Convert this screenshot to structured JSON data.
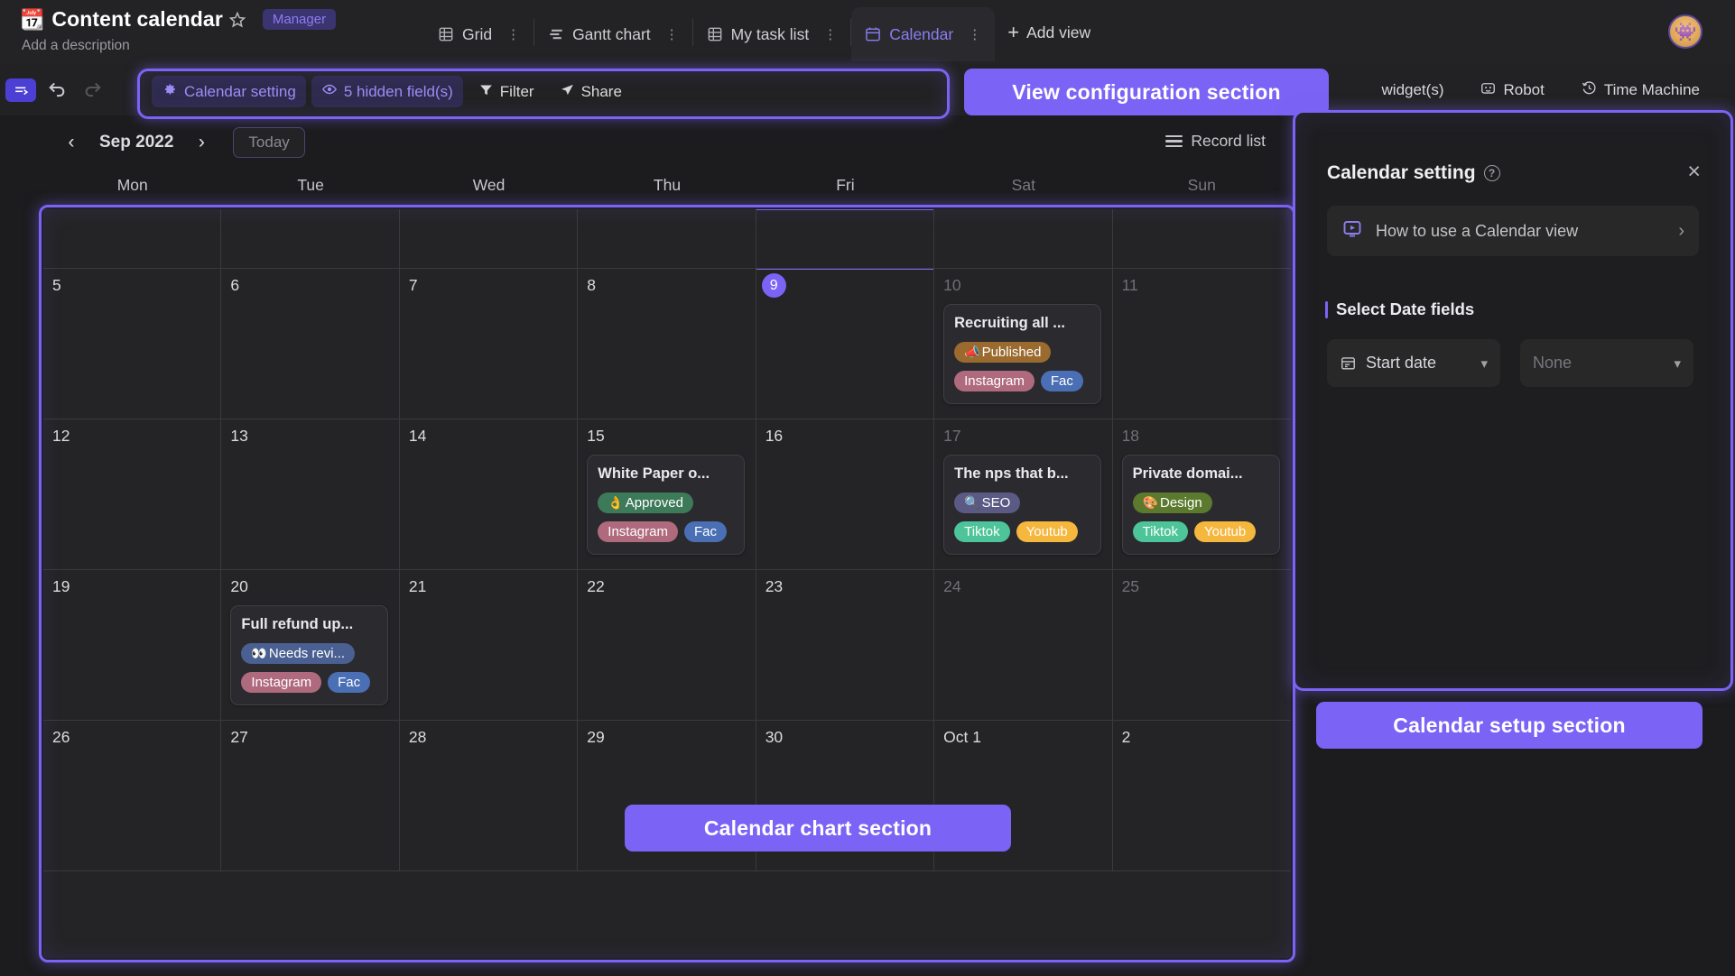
{
  "titlebar": {
    "icon": "calendar-emoji-icon",
    "title": "Content calendar",
    "badge": "Manager",
    "description": "Add a description"
  },
  "tabs": [
    {
      "label": "Grid",
      "icon": "grid-icon",
      "active": false
    },
    {
      "label": "Gantt chart",
      "icon": "gantt-icon",
      "active": false
    },
    {
      "label": "My task list",
      "icon": "list-icon",
      "active": false
    },
    {
      "label": "Calendar",
      "icon": "calendar-icon",
      "active": true
    }
  ],
  "add_view": "Add view",
  "toolbar": {
    "calendar_setting": "Calendar setting",
    "hidden_fields": "5 hidden field(s)",
    "filter": "Filter",
    "share": "Share",
    "widgets": "widget(s)",
    "robot": "Robot",
    "time_machine": "Time Machine"
  },
  "annotations": {
    "view_configuration": "View configuration section",
    "calendar_setup": "Calendar setup section",
    "calendar_chart": "Calendar chart section"
  },
  "calendar_header": {
    "prev": "‹",
    "month": "Sep 2022",
    "next": "›",
    "today": "Today",
    "record_list": "Record list"
  },
  "weekdays": [
    {
      "label": "Mon",
      "dim": false
    },
    {
      "label": "Tue",
      "dim": false
    },
    {
      "label": "Wed",
      "dim": false
    },
    {
      "label": "Thu",
      "dim": false
    },
    {
      "label": "Fri",
      "dim": false
    },
    {
      "label": "Sat",
      "dim": true
    },
    {
      "label": "Sun",
      "dim": true
    }
  ],
  "chart_data": {
    "type": "table",
    "title": "Sep 2022",
    "columns": [
      "Mon",
      "Tue",
      "Wed",
      "Thu",
      "Fri",
      "Sat",
      "Sun"
    ],
    "rows": [
      [
        {
          "day": "",
          "dim": false,
          "today": false,
          "events": []
        },
        {
          "day": "",
          "dim": false,
          "today": false,
          "events": []
        },
        {
          "day": "",
          "dim": false,
          "today": false,
          "events": []
        },
        {
          "day": "",
          "dim": false,
          "today": false,
          "events": []
        },
        {
          "day": "",
          "dim": false,
          "today": false,
          "events": [],
          "today_col": true
        },
        {
          "day": "",
          "dim": false,
          "today": false,
          "events": []
        },
        {
          "day": "",
          "dim": false,
          "today": false,
          "events": []
        }
      ],
      [
        {
          "day": "5",
          "dim": false,
          "today": false,
          "events": []
        },
        {
          "day": "6",
          "dim": false,
          "today": false,
          "events": []
        },
        {
          "day": "7",
          "dim": false,
          "today": false,
          "events": []
        },
        {
          "day": "8",
          "dim": false,
          "today": false,
          "events": []
        },
        {
          "day": "9",
          "dim": false,
          "today": true,
          "events": [],
          "today_col": true
        },
        {
          "day": "10",
          "dim": true,
          "today": false,
          "events": [
            {
              "title": "Recruiting all ...",
              "status": {
                "label": "Published",
                "emoji": "📣",
                "color": "#9a6a2e"
              },
              "channels": [
                {
                  "label": "Instagram",
                  "color": "#b06a7e"
                },
                {
                  "label": "Fac",
                  "color": "#4a6fb5"
                }
              ]
            }
          ]
        },
        {
          "day": "11",
          "dim": true,
          "today": false,
          "events": []
        }
      ],
      [
        {
          "day": "12",
          "dim": false,
          "today": false,
          "events": []
        },
        {
          "day": "13",
          "dim": false,
          "today": false,
          "events": []
        },
        {
          "day": "14",
          "dim": false,
          "today": false,
          "events": []
        },
        {
          "day": "15",
          "dim": false,
          "today": false,
          "events": [
            {
              "title": "White Paper o...",
              "status": {
                "label": "Approved",
                "emoji": "👌",
                "color": "#3d7a5a"
              },
              "channels": [
                {
                  "label": "Instagram",
                  "color": "#b06a7e"
                },
                {
                  "label": "Fac",
                  "color": "#4a6fb5"
                }
              ]
            }
          ]
        },
        {
          "day": "16",
          "dim": false,
          "today": false,
          "events": []
        },
        {
          "day": "17",
          "dim": true,
          "today": false,
          "events": [
            {
              "title": "The nps that b...",
              "status": {
                "label": "SEO",
                "emoji": "🔍",
                "color": "#5a5a85"
              },
              "channels": [
                {
                  "label": "Tiktok",
                  "color": "#4ec49a"
                },
                {
                  "label": "Youtub",
                  "color": "#f5b73e"
                }
              ]
            }
          ]
        },
        {
          "day": "18",
          "dim": true,
          "today": false,
          "events": [
            {
              "title": "Private domai...",
              "status": {
                "label": "Design",
                "emoji": "🎨",
                "color": "#5b7a2e"
              },
              "channels": [
                {
                  "label": "Tiktok",
                  "color": "#4ec49a"
                },
                {
                  "label": "Youtub",
                  "color": "#f5b73e"
                }
              ]
            }
          ]
        }
      ],
      [
        {
          "day": "19",
          "dim": false,
          "today": false,
          "events": []
        },
        {
          "day": "20",
          "dim": false,
          "today": false,
          "events": [
            {
              "title": "Full refund up...",
              "status": {
                "label": "Needs revi...",
                "emoji": "👀",
                "color": "#4a6092"
              },
              "channels": [
                {
                  "label": "Instagram",
                  "color": "#b06a7e"
                },
                {
                  "label": "Fac",
                  "color": "#4a6fb5"
                }
              ]
            }
          ]
        },
        {
          "day": "21",
          "dim": false,
          "today": false,
          "events": []
        },
        {
          "day": "22",
          "dim": false,
          "today": false,
          "events": []
        },
        {
          "day": "23",
          "dim": false,
          "today": false,
          "events": []
        },
        {
          "day": "24",
          "dim": true,
          "today": false,
          "events": []
        },
        {
          "day": "25",
          "dim": true,
          "today": false,
          "events": []
        }
      ],
      [
        {
          "day": "26",
          "dim": false,
          "today": false,
          "events": []
        },
        {
          "day": "27",
          "dim": false,
          "today": false,
          "events": []
        },
        {
          "day": "28",
          "dim": false,
          "today": false,
          "events": []
        },
        {
          "day": "29",
          "dim": false,
          "today": false,
          "events": []
        },
        {
          "day": "30",
          "dim": false,
          "today": false,
          "events": []
        },
        {
          "day": "Oct 1",
          "dim": false,
          "today": false,
          "events": []
        },
        {
          "day": "2",
          "dim": false,
          "today": false,
          "events": []
        }
      ]
    ]
  },
  "panel": {
    "title": "Calendar setting",
    "close": "×",
    "howto": "How to use a Calendar view",
    "section_label": "Select Date fields",
    "date_start": "Start date",
    "date_end": "None"
  },
  "colors": {
    "accent": "#7b63f5",
    "bg": "#1c1c1e",
    "panel_bg": "#1e1e20",
    "cell_bg": "#242426"
  }
}
